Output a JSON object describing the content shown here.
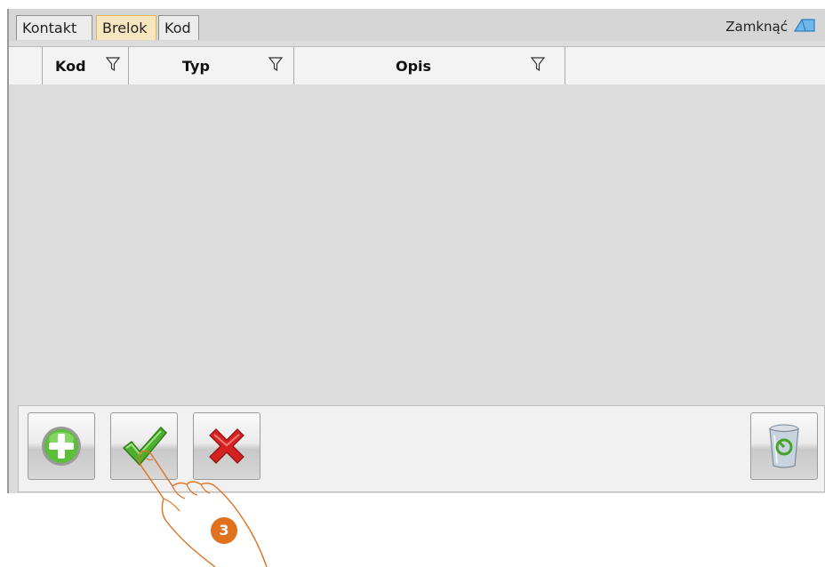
{
  "tabs": [
    {
      "label": "Kontakt",
      "active": false
    },
    {
      "label": "Brelok",
      "active": true
    },
    {
      "label": "Kod",
      "active": false
    }
  ],
  "close": {
    "label": "Zamknąć",
    "icon": "door-close-icon"
  },
  "grid": {
    "columns": [
      {
        "label": "Kod",
        "filter_icon": "filter-icon"
      },
      {
        "label": "Typ",
        "filter_icon": "filter-icon"
      },
      {
        "label": "Opis",
        "filter_icon": "filter-icon"
      }
    ],
    "rows": []
  },
  "toolbar": {
    "buttons": [
      {
        "name": "add-button",
        "icon": "plus-circle-icon"
      },
      {
        "name": "confirm-button",
        "icon": "checkmark-icon"
      },
      {
        "name": "cancel-button",
        "icon": "x-icon"
      },
      {
        "name": "delete-button",
        "icon": "trash-bin-icon"
      }
    ]
  },
  "annotation": {
    "step_number": "3"
  },
  "colors": {
    "active_tab": "#f7e6c0",
    "accent_orange": "#e0711f",
    "check_green": "#4caf2e",
    "cross_red": "#d42121"
  }
}
